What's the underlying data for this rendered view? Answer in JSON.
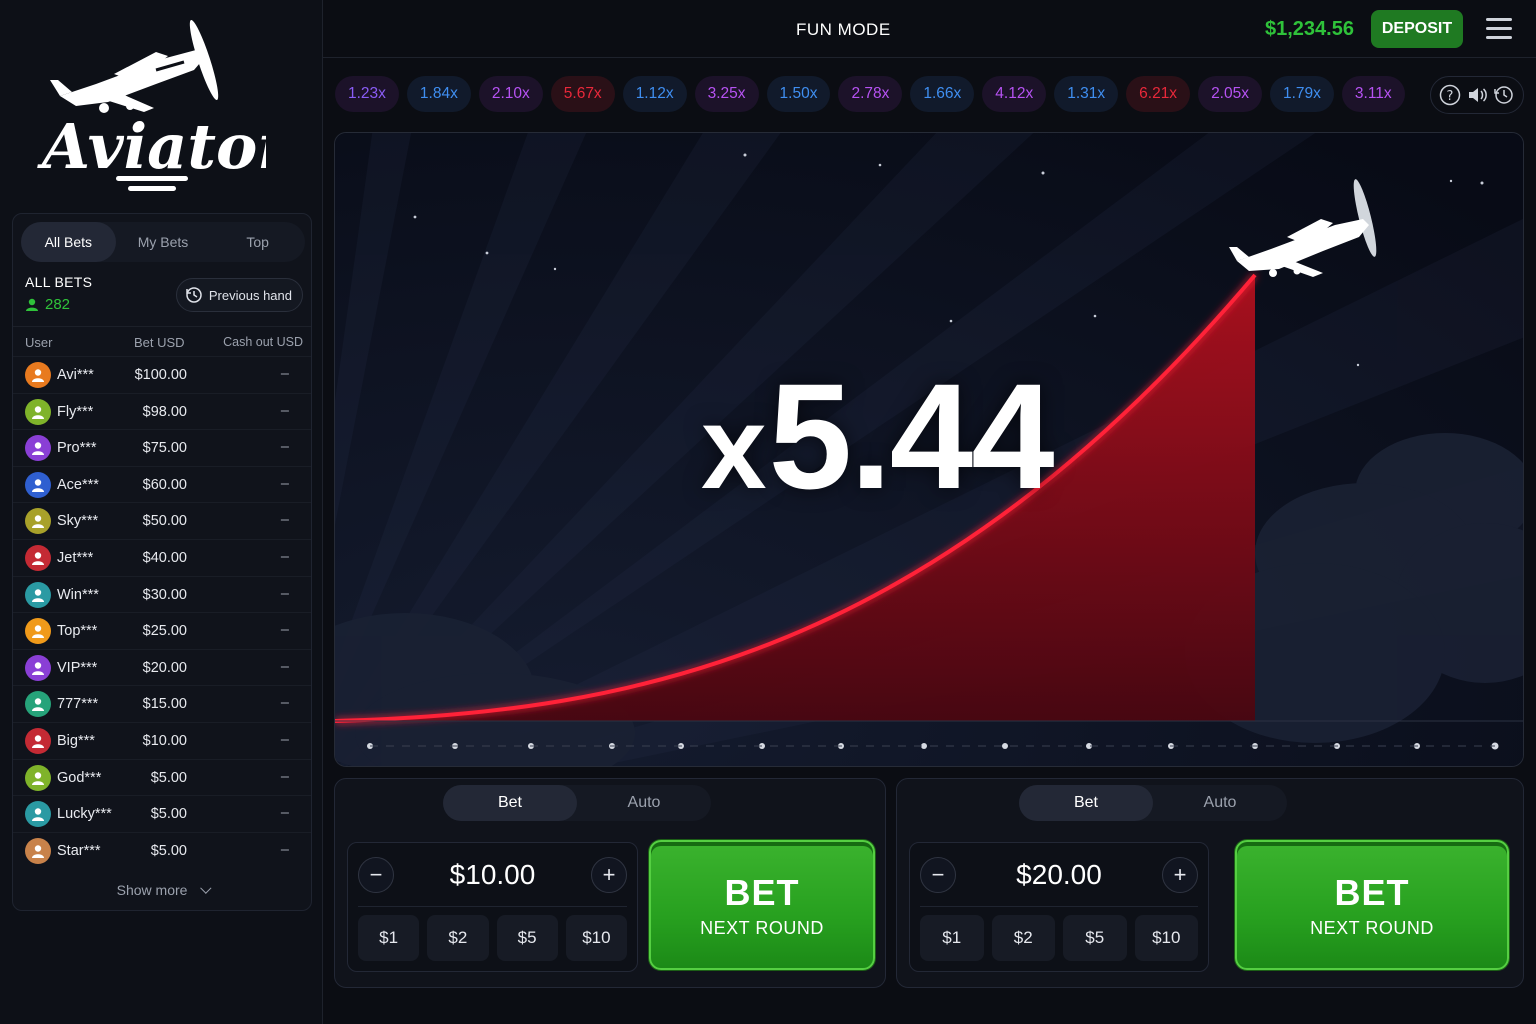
{
  "app": {
    "name": "Aviator"
  },
  "header": {
    "mode": "FUN MODE",
    "balance": "$1,234.56",
    "deposit_label": "DEPOSIT"
  },
  "history": [
    {
      "value": "1.23x",
      "color": "#8a5cf5"
    },
    {
      "value": "1.84x",
      "color": "#3f8ef0"
    },
    {
      "value": "2.10x",
      "color": "#b652f2"
    },
    {
      "value": "5.67x",
      "color": "#e8283a"
    },
    {
      "value": "1.12x",
      "color": "#3f8ef0"
    },
    {
      "value": "3.25x",
      "color": "#b652f2"
    },
    {
      "value": "1.50x",
      "color": "#3f8ef0"
    },
    {
      "value": "2.78x",
      "color": "#b652f2"
    },
    {
      "value": "1.66x",
      "color": "#3f8ef0"
    },
    {
      "value": "4.12x",
      "color": "#b652f2"
    },
    {
      "value": "1.31x",
      "color": "#3f8ef0"
    },
    {
      "value": "6.21x",
      "color": "#e8283a"
    },
    {
      "value": "2.05x",
      "color": "#b652f2"
    },
    {
      "value": "1.79x",
      "color": "#3f8ef0"
    },
    {
      "value": "3.11x",
      "color": "#b652f2"
    }
  ],
  "sidebar": {
    "tabs": [
      "All Bets",
      "My Bets",
      "Top"
    ],
    "active_tab": "All Bets",
    "all_bets_title": "ALL BETS",
    "all_bets_count": "282",
    "previous_hand": "Previous hand",
    "columns": [
      "User",
      "Bet USD",
      "Cash out USD"
    ],
    "rows": [
      {
        "user": "Avi***",
        "bet": "$100.00",
        "cashout": "–",
        "avatar_color": "#e87a1f"
      },
      {
        "user": "Fly***",
        "bet": "$98.00",
        "cashout": "–",
        "avatar_color": "#7fb32a"
      },
      {
        "user": "Pro***",
        "bet": "$75.00",
        "cashout": "–",
        "avatar_color": "#8a3fd6"
      },
      {
        "user": "Ace***",
        "bet": "$60.00",
        "cashout": "–",
        "avatar_color": "#2f5fd0"
      },
      {
        "user": "Sky***",
        "bet": "$50.00",
        "cashout": "–",
        "avatar_color": "#a8a12a"
      },
      {
        "user": "Jet***",
        "bet": "$40.00",
        "cashout": "–",
        "avatar_color": "#c42a34"
      },
      {
        "user": "Win***",
        "bet": "$30.00",
        "cashout": "–",
        "avatar_color": "#2a9aa3"
      },
      {
        "user": "Top***",
        "bet": "$25.00",
        "cashout": "–",
        "avatar_color": "#f09a1a"
      },
      {
        "user": "VIP***",
        "bet": "$20.00",
        "cashout": "–",
        "avatar_color": "#8a3fd6"
      },
      {
        "user": "777***",
        "bet": "$15.00",
        "cashout": "–",
        "avatar_color": "#26a37a"
      },
      {
        "user": "Big***",
        "bet": "$10.00",
        "cashout": "–",
        "avatar_color": "#c42a34"
      },
      {
        "user": "God***",
        "bet": "$5.00",
        "cashout": "–",
        "avatar_color": "#7fb32a"
      },
      {
        "user": "Lucky***",
        "bet": "$5.00",
        "cashout": "–",
        "avatar_color": "#2a9aa3"
      },
      {
        "user": "Star***",
        "bet": "$5.00",
        "cashout": "–",
        "avatar_color": "#c8824a"
      }
    ],
    "show_more": "Show more"
  },
  "game": {
    "multiplier_prefix": "x",
    "multiplier": "5.44",
    "line_color": "#e8192c"
  },
  "bet_panels": [
    {
      "tabs": [
        "Bet",
        "Auto"
      ],
      "amount": "$10.00",
      "chips": [
        "$1",
        "$2",
        "$5",
        "$10"
      ],
      "button_title": "BET",
      "button_subtitle": "NEXT ROUND"
    },
    {
      "tabs": [
        "Bet",
        "Auto"
      ],
      "amount": "$20.00",
      "chips": [
        "$1",
        "$2",
        "$5",
        "$10"
      ],
      "button_title": "BET",
      "button_subtitle": "NEXT ROUND"
    }
  ]
}
